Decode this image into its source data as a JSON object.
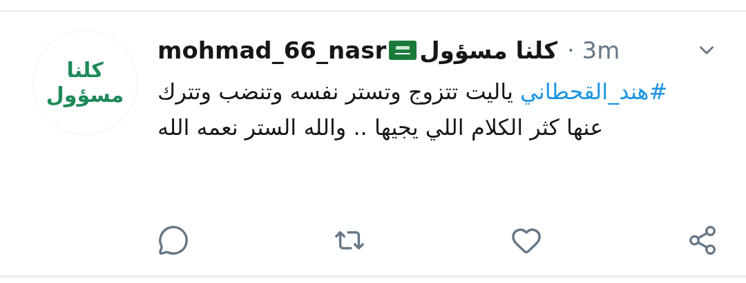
{
  "tweet": {
    "avatar_logo": [
      "كلنا",
      "مسؤول"
    ],
    "name": "mohmad_66_nasr",
    "display_name": "كلنا مسؤول",
    "time": "· 3m",
    "hashtag": "#هند_القحطاني",
    "text": "ياليت تتزوج وتستر نفسه وتنضب وتترك عنها كثر الكلام اللي يجيها .. والله الستر نعمه الله",
    "actions": [
      {
        "kind": "reply"
      },
      {
        "kind": "retweet"
      },
      {
        "kind": "like"
      },
      {
        "kind": "share"
      }
    ]
  }
}
